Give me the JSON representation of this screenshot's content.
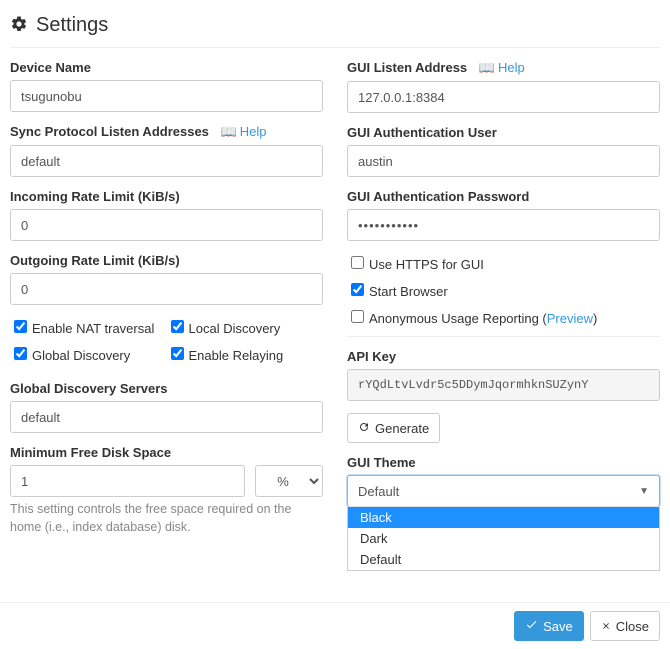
{
  "header": {
    "title": "Settings"
  },
  "left": {
    "device_name": {
      "label": "Device Name",
      "value": "tsugunobu"
    },
    "sync_addresses": {
      "label": "Sync Protocol Listen Addresses",
      "value": "default",
      "help": "Help"
    },
    "incoming_rate": {
      "label": "Incoming Rate Limit (KiB/s)",
      "value": "0"
    },
    "outgoing_rate": {
      "label": "Outgoing Rate Limit (KiB/s)",
      "value": "0"
    },
    "checks": {
      "nat": "Enable NAT traversal",
      "local": "Local Discovery",
      "global": "Global Discovery",
      "relay": "Enable Relaying"
    },
    "discovery_servers": {
      "label": "Global Discovery Servers",
      "value": "default"
    },
    "min_free": {
      "label": "Minimum Free Disk Space",
      "value": "1",
      "unit": "%",
      "help": "This setting controls the free space required on the home (i.e., index database) disk."
    }
  },
  "right": {
    "listen_addr": {
      "label": "GUI Listen Address",
      "value": "127.0.0.1:8384",
      "help": "Help"
    },
    "auth_user": {
      "label": "GUI Authentication User",
      "value": "austin"
    },
    "auth_pass": {
      "label": "GUI Authentication Password",
      "value": "•••••••••••"
    },
    "checks": {
      "https": "Use HTTPS for GUI",
      "browser": "Start Browser",
      "usage": "Anonymous Usage Reporting (",
      "preview": "Preview",
      "close_paren": ")"
    },
    "api": {
      "label": "API Key",
      "value": "rYQdLtvLvdr5c5DDymJqormhknSUZynY",
      "generate": "Generate"
    },
    "theme": {
      "label": "GUI Theme",
      "selected": "Default",
      "options": [
        "Black",
        "Dark",
        "Default"
      ]
    }
  },
  "footer": {
    "save": "Save",
    "close": "Close"
  }
}
